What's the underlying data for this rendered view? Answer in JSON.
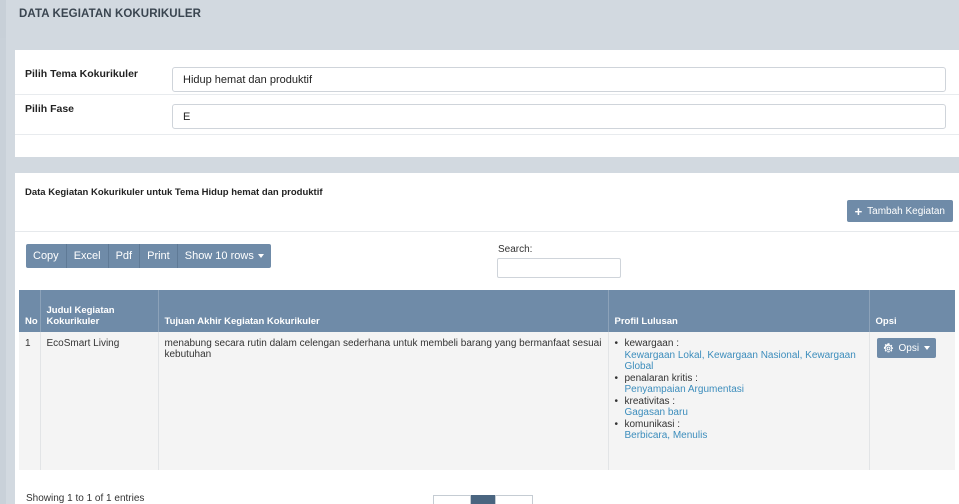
{
  "header": {
    "title": "DATA KEGIATAN KOKURIKULER"
  },
  "filter": {
    "tema_label": "Pilih Tema Kokurikuler",
    "tema_value": "Hidup hemat dan produktif",
    "fase_label": "Pilih Fase",
    "fase_value": "E"
  },
  "main": {
    "section_title": "Data Kegiatan Kokurikuler untuk Tema Hidup hemat dan produktif",
    "add_button": "Tambah Kegiatan",
    "toolbar": {
      "copy": "Copy",
      "excel": "Excel",
      "pdf": "Pdf",
      "print": "Print",
      "show_rows": "Show 10 rows"
    },
    "search_label": "Search:",
    "table": {
      "headers": [
        "No",
        "Judul Kegiatan Kokurikuler",
        "Tujuan Akhir Kegiatan Kokurikuler",
        "Profil Lulusan",
        "Opsi"
      ],
      "rows": [
        {
          "no": "1",
          "judul": "EcoSmart Living",
          "tujuan": "menabung secara rutin dalam celengan sederhana untuk membeli barang yang bermanfaat sesuai kebutuhan",
          "profil": [
            {
              "name": "kewargaan :",
              "sub": "Kewargaan Lokal, Kewargaan Nasional, Kewargaan Global"
            },
            {
              "name": "penalaran kritis :",
              "sub": "Penyampaian Argumentasi"
            },
            {
              "name": "kreativitas :",
              "sub": "Gagasan baru"
            },
            {
              "name": "komunikasi :",
              "sub": "Berbicara, Menulis"
            }
          ],
          "opsi": "Opsi"
        }
      ]
    },
    "showing": "Showing 1 to 1 of 1 entries"
  },
  "icons": {
    "add": "plus-icon",
    "opsi": "gear-icon",
    "dropdown": "caret-down-icon"
  },
  "colors": {
    "button": "#6f8ba8",
    "link": "#3c8dbc",
    "page_bg": "#d2d9e0"
  }
}
